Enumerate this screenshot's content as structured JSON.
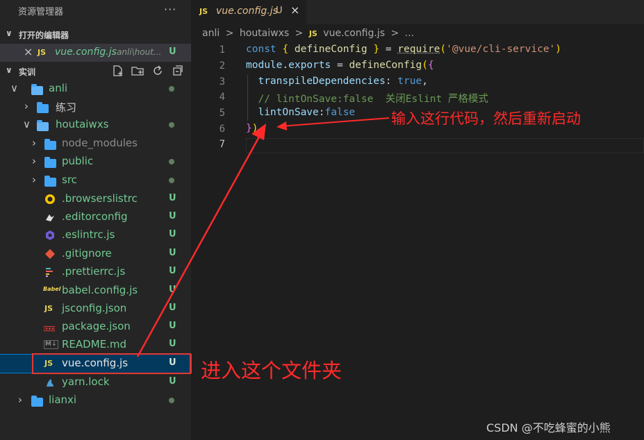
{
  "sidebar": {
    "title": "资源管理器",
    "more": "···",
    "open_editors": {
      "label": "打开的编辑器",
      "items": [
        {
          "close": "×",
          "icon": "JS",
          "name": "vue.config.js",
          "path": "anli\\hout...",
          "status": "U"
        }
      ]
    },
    "workspace": {
      "label": "实训",
      "tree": [
        {
          "name": "anli",
          "kind": "folder-open"
        },
        {
          "name": "练习",
          "kind": "folder"
        },
        {
          "name": "houtaiwxs",
          "kind": "folder-open"
        },
        {
          "name": "node_modules",
          "kind": "folder"
        },
        {
          "name": "public",
          "kind": "folder"
        },
        {
          "name": "src",
          "kind": "folder"
        },
        {
          "name": ".browserslistrc",
          "status": "U",
          "icon": "browserslist-icon"
        },
        {
          "name": ".editorconfig",
          "status": "U",
          "icon": "editorconfig-icon"
        },
        {
          "name": ".eslintrc.js",
          "status": "U",
          "icon": "eslint-icon"
        },
        {
          "name": ".gitignore",
          "status": "U",
          "icon": "git-icon"
        },
        {
          "name": ".prettierrc.js",
          "status": "U",
          "icon": "prettier-icon"
        },
        {
          "name": "babel.config.js",
          "status": "U",
          "icon": "babel-icon",
          "icon_text": "Babel"
        },
        {
          "name": "jsconfig.json",
          "status": "U",
          "icon": "js-icon",
          "icon_text": "JS"
        },
        {
          "name": "package.json",
          "status": "U",
          "icon": "npm-icon"
        },
        {
          "name": "README.md",
          "status": "U",
          "icon": "markdown-icon",
          "icon_text": "M↓"
        },
        {
          "name": "vue.config.js",
          "status": "U",
          "icon": "js-icon",
          "icon_text": "JS"
        },
        {
          "name": "yarn.lock",
          "status": "U",
          "icon": "yarn-icon"
        },
        {
          "name": "lianxi",
          "kind": "folder"
        }
      ]
    }
  },
  "editor": {
    "tab": {
      "icon": "JS",
      "label": "vue.config.js",
      "status": "U",
      "close": "×"
    },
    "breadcrumb": [
      "anli",
      ">",
      "houtaiwxs",
      ">",
      "JS",
      "vue.config.js",
      ">",
      "..."
    ],
    "line_numbers": [
      "1",
      "2",
      "3",
      "4",
      "5",
      "6",
      "7"
    ],
    "code": {
      "l1": {
        "a": "const",
        "b": "{",
        "c": "defineConfig",
        "d": "}",
        "e": "=",
        "f": "require",
        "g": "(",
        "h": "'@vue/cli-service'",
        "i": ")"
      },
      "l2": {
        "a": "module",
        "b": ".",
        "c": "exports",
        "d": "=",
        "e": "defineConfig",
        "f": "(",
        "g": "{"
      },
      "l3": {
        "a": "transpileDependencies",
        "b": ":",
        "c": "true",
        "d": ","
      },
      "l4": {
        "a": "// lintOnSave:false  关闭Eslint 严格模式"
      },
      "l5": {
        "a": "lintOnSave",
        "b": ":",
        "c": "false"
      },
      "l6": {
        "a": "}",
        "b": ")"
      }
    }
  },
  "annotations": {
    "top_note": "输入这行代码，然后重新启动",
    "bottom_note": "进入这个文件夹",
    "watermark": "CSDN @不吃蜂蜜的小熊"
  },
  "colors": {
    "annotation_red": "#ff2a2a",
    "untracked_green": "#73c991",
    "modified_tab": "#e2c08d",
    "selection": "#04395e"
  }
}
